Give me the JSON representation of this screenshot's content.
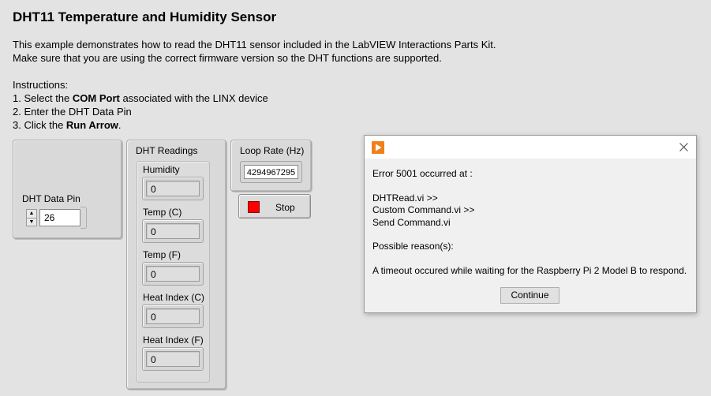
{
  "title": "DHT11 Temperature and Humidity Sensor",
  "description": [
    "This example demonstrates how to read the DHT11 sensor included in the LabVIEW Interactions Parts Kit.",
    "Make sure that you are using the correct firmware version so the DHT functions are supported."
  ],
  "instructions": {
    "heading": "Instructions:",
    "step1_prefix": "1. Select the ",
    "step1_bold": "COM Port",
    "step1_suffix": " associated with the LINX device",
    "step2": "2. Enter the DHT Data Pin",
    "step3_prefix": "3. Click the ",
    "step3_bold": "Run Arrow",
    "step3_suffix": "."
  },
  "dht_pin": {
    "label": "DHT Data Pin",
    "value": "26"
  },
  "readings": {
    "title": "DHT Readings",
    "items": [
      {
        "label": "Humidity",
        "value": "0"
      },
      {
        "label": "Temp (C)",
        "value": "0"
      },
      {
        "label": "Temp (F)",
        "value": "0"
      },
      {
        "label": "Heat Index (C)",
        "value": "0"
      },
      {
        "label": "Heat Index (F)",
        "value": "0"
      }
    ]
  },
  "loop_rate": {
    "label": "Loop Rate (Hz)",
    "value": "4294967295"
  },
  "stop_button": {
    "label": "Stop",
    "color": "#ff0000"
  },
  "dialog": {
    "icon": "labview-icon",
    "close_icon": "close-icon",
    "line1": "Error 5001 occurred at :",
    "trace": [
      "DHTRead.vi >>",
      "Custom Command.vi >>",
      "Send Command.vi"
    ],
    "reason_heading": "Possible reason(s):",
    "reason": "A timeout occured while waiting for the Raspberry Pi 2 Model B to respond.",
    "continue_label": "Continue"
  }
}
